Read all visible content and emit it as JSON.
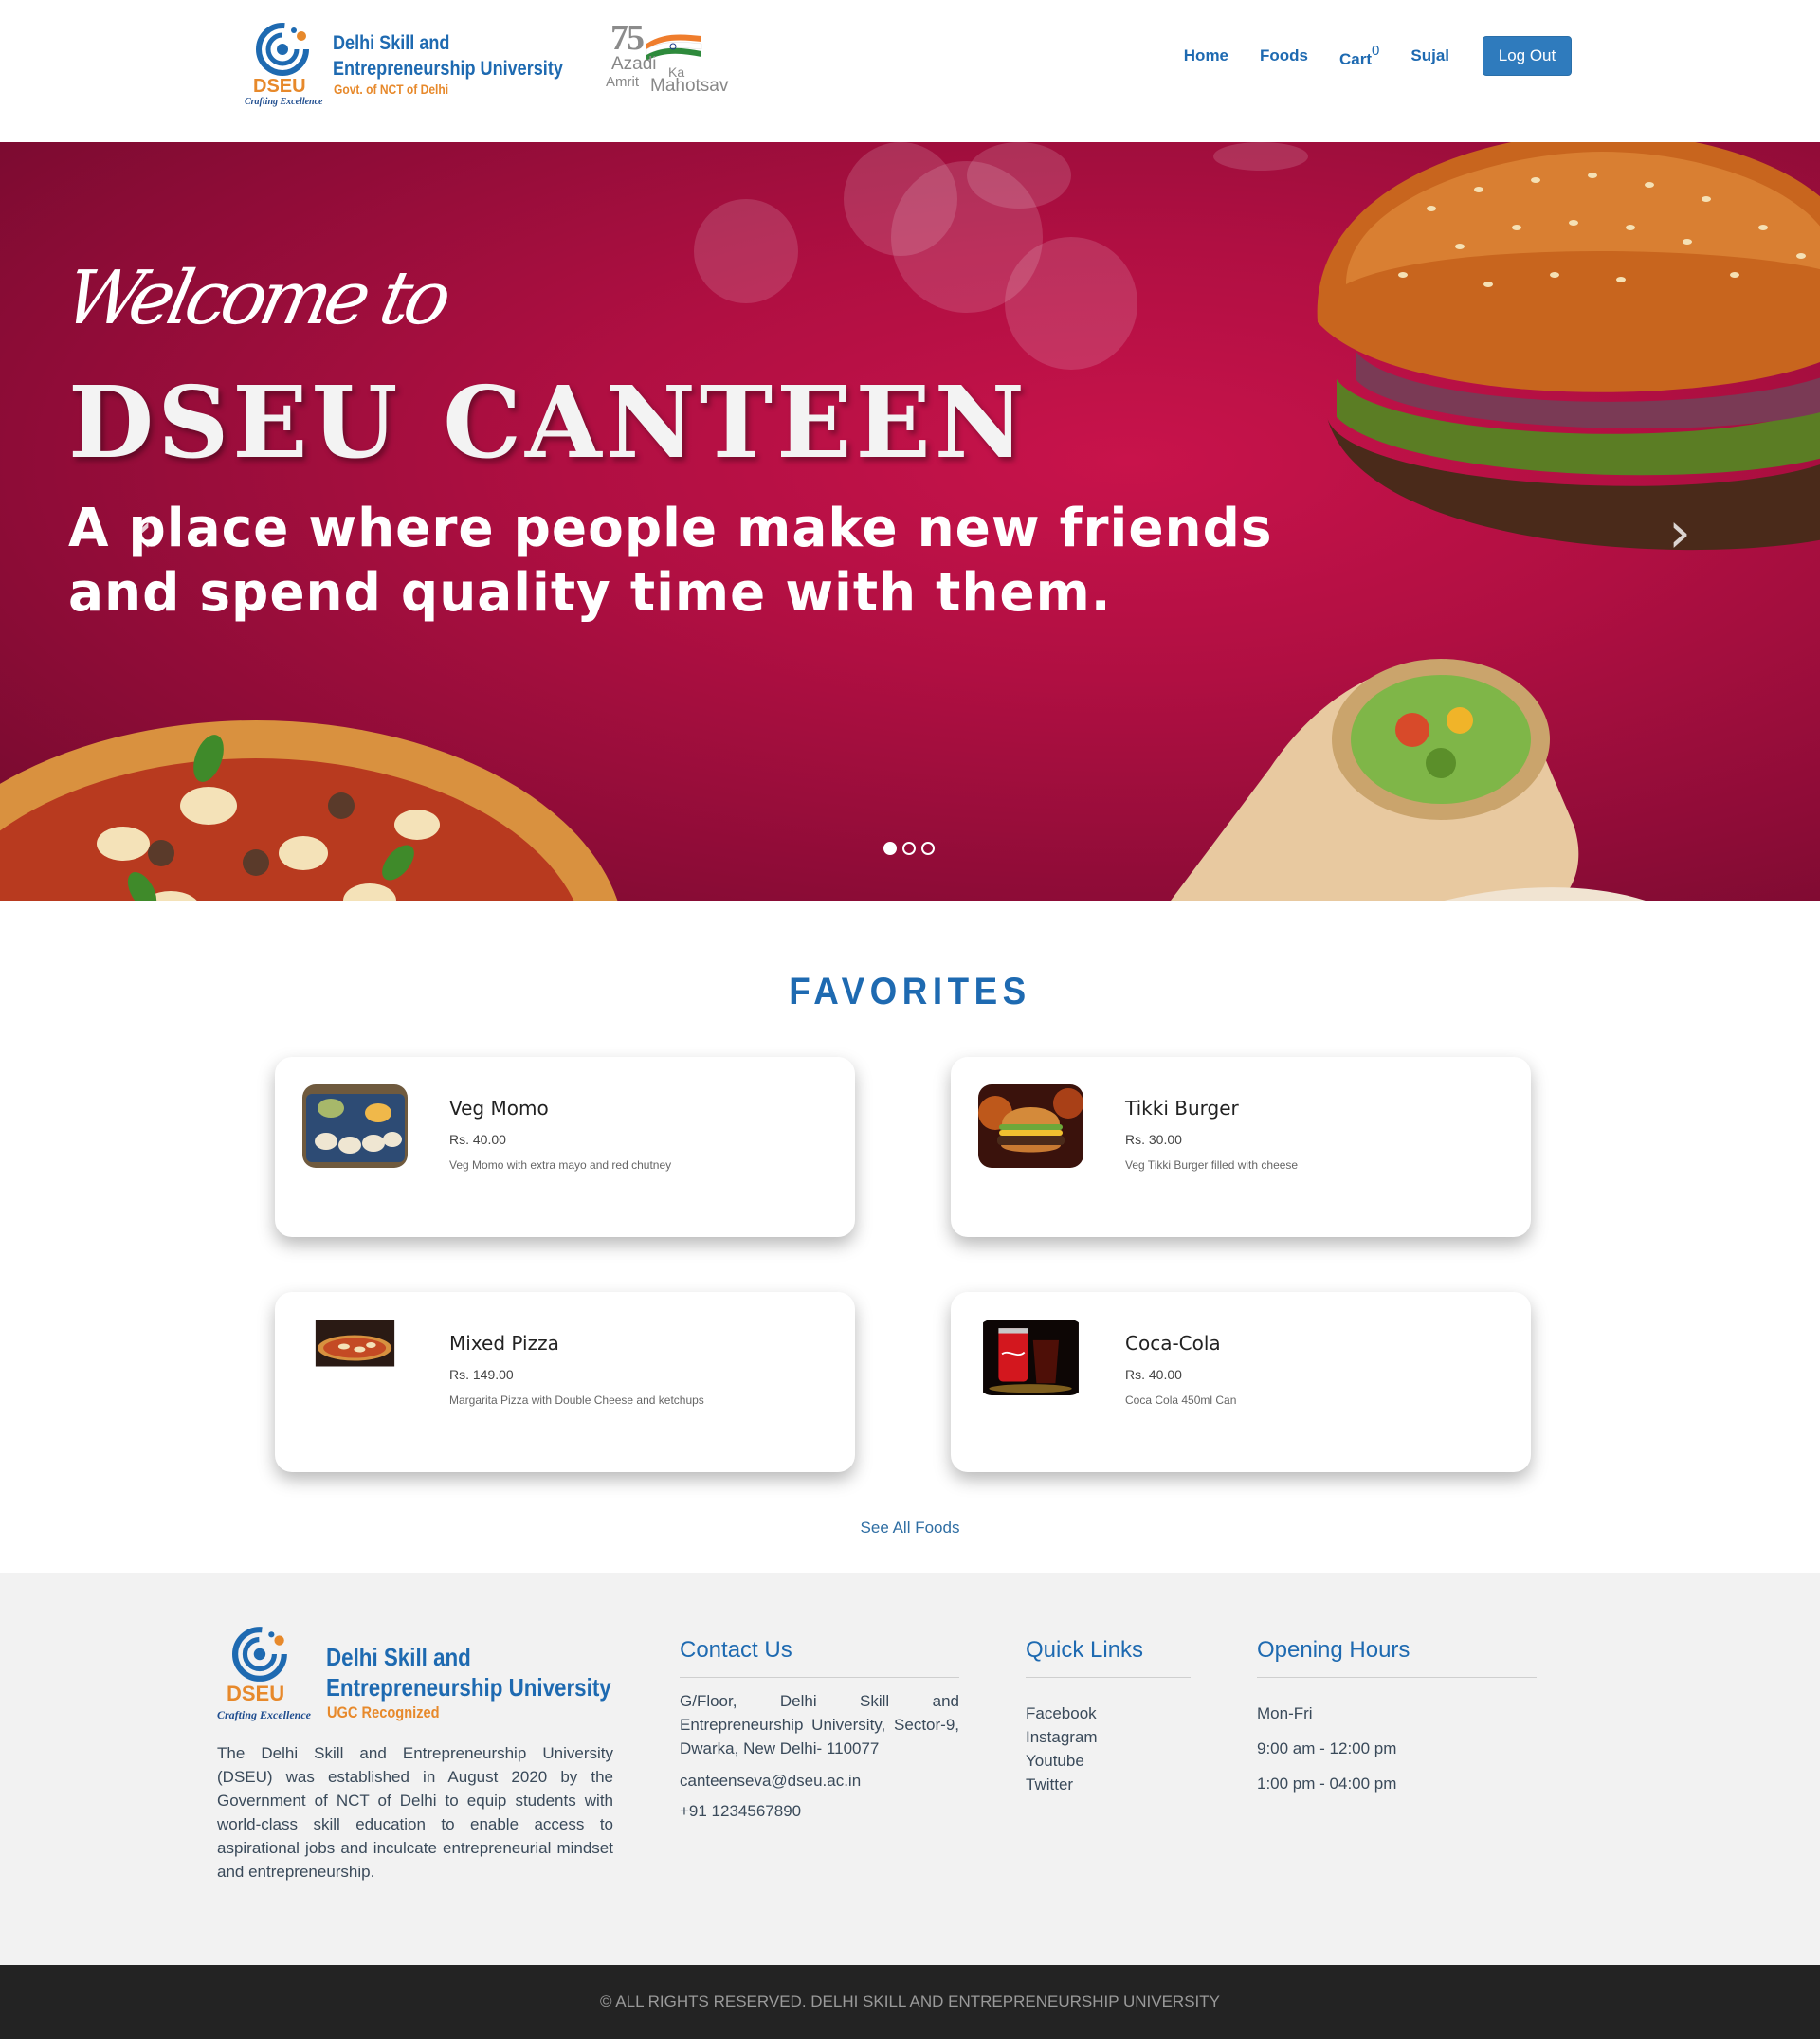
{
  "header": {
    "brand_name_line1": "Delhi Skill and",
    "brand_name_line2": "Entrepreneurship University",
    "brand_sub": "Govt. of NCT of Delhi",
    "brand_short": "DSEU",
    "brand_tagline": "Crafting Excellence",
    "azadi_line1": "Azadi",
    "azadi_ka": "Ka",
    "azadi_line2a": "Amrit",
    "azadi_line2b": "Mahotsav",
    "nav": {
      "home": "Home",
      "foods": "Foods",
      "cart": "Cart",
      "cart_count": "0",
      "user": "Sujal",
      "logout": "Log Out"
    },
    "colors": {
      "primary": "#1e6ab1",
      "accent": "#e7892b",
      "button": "#2f7bbd"
    }
  },
  "hero": {
    "welcome": "Welcome to",
    "title_part1": "DSEU",
    "title_part2": "CANTEEN",
    "tagline_line1": "A place where people make new friends",
    "tagline_line2": "and spend quality time with them.",
    "prev_icon": "chevron-left-icon",
    "next_icon": "chevron-right-icon",
    "slides": 3,
    "active_slide": 1,
    "background_color": "#b00f42"
  },
  "favorites": {
    "heading": "FAVORITES",
    "items": [
      {
        "name": "Veg Momo",
        "price": "Rs. 40.00",
        "desc": "Veg Momo with extra mayo and red chutney"
      },
      {
        "name": "Tikki Burger",
        "price": "Rs. 30.00",
        "desc": "Veg Tikki Burger filled with cheese"
      },
      {
        "name": "Mixed Pizza",
        "price": "Rs. 149.00",
        "desc": "Margarita Pizza with Double Cheese and ketchups"
      },
      {
        "name": "Coca-Cola",
        "price": "Rs. 40.00",
        "desc": "Coca Cola 450ml Can"
      }
    ],
    "see_all": "See All Foods"
  },
  "footer": {
    "brand_short": "DSEU",
    "brand_tagline": "Crafting Excellence",
    "brand_name_line1": "Delhi Skill and",
    "brand_name_line2": "Entrepreneurship University",
    "brand_sub": "UGC Recognized",
    "about": "The Delhi Skill and Entrepreneurship University (DSEU) was established in August 2020 by the Government of NCT of Delhi to equip students with world-class skill education to enable access to aspirational jobs and inculcate entrepreneurial mindset and entrepreneurship.",
    "contact": {
      "heading": "Contact Us",
      "address": "G/Floor, Delhi Skill and Entrepreneurship University, Sector-9, Dwarka, New Delhi- 110077",
      "email": "canteenseva@dseu.ac.in",
      "phone": "+91 1234567890"
    },
    "quick_links": {
      "heading": "Quick Links",
      "items": [
        "Facebook",
        "Instagram",
        "Youtube",
        "Twitter"
      ]
    },
    "hours": {
      "heading": "Opening Hours",
      "days": "Mon-Fri",
      "slot1": "9:00 am - 12:00 pm",
      "slot2": "1:00 pm - 04:00 pm"
    },
    "copyright": "© ALL RIGHTS RESERVED. DELHI SKILL AND ENTREPRENEURSHIP UNIVERSITY"
  }
}
